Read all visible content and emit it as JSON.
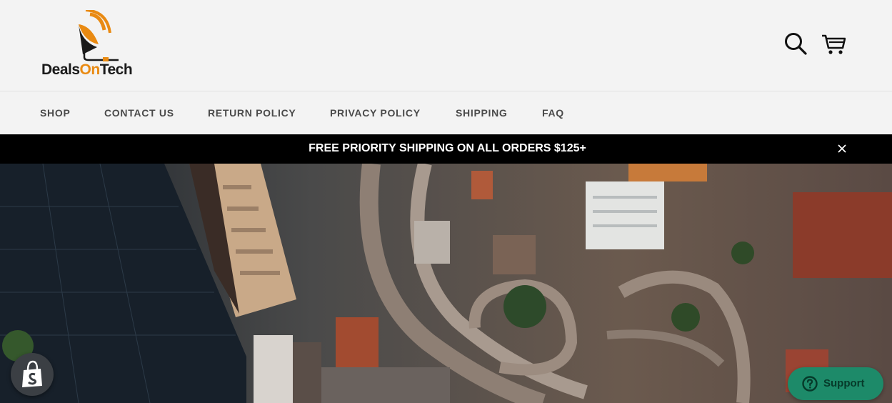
{
  "brand": {
    "name_part1": "Deals",
    "name_part2": "On",
    "name_part3": "Tech",
    "accent_color": "#e98a12"
  },
  "header": {
    "search_icon": "search-icon",
    "cart_icon": "cart-icon"
  },
  "nav": {
    "items": [
      {
        "label": "SHOP"
      },
      {
        "label": "CONTACT US"
      },
      {
        "label": "RETURN POLICY"
      },
      {
        "label": "PRIVACY POLICY"
      },
      {
        "label": "SHIPPING"
      },
      {
        "label": "FAQ"
      }
    ]
  },
  "announcement": {
    "text": "FREE PRIORITY SHIPPING ON ALL ORDERS $125+",
    "close_icon": "close-icon"
  },
  "hero": {
    "image": "aerial-city-highway-photo"
  },
  "widgets": {
    "shopify_icon": "shopify-bag-icon",
    "support_label": "Support",
    "support_icon": "help-icon",
    "support_color": "#1d8a69"
  }
}
